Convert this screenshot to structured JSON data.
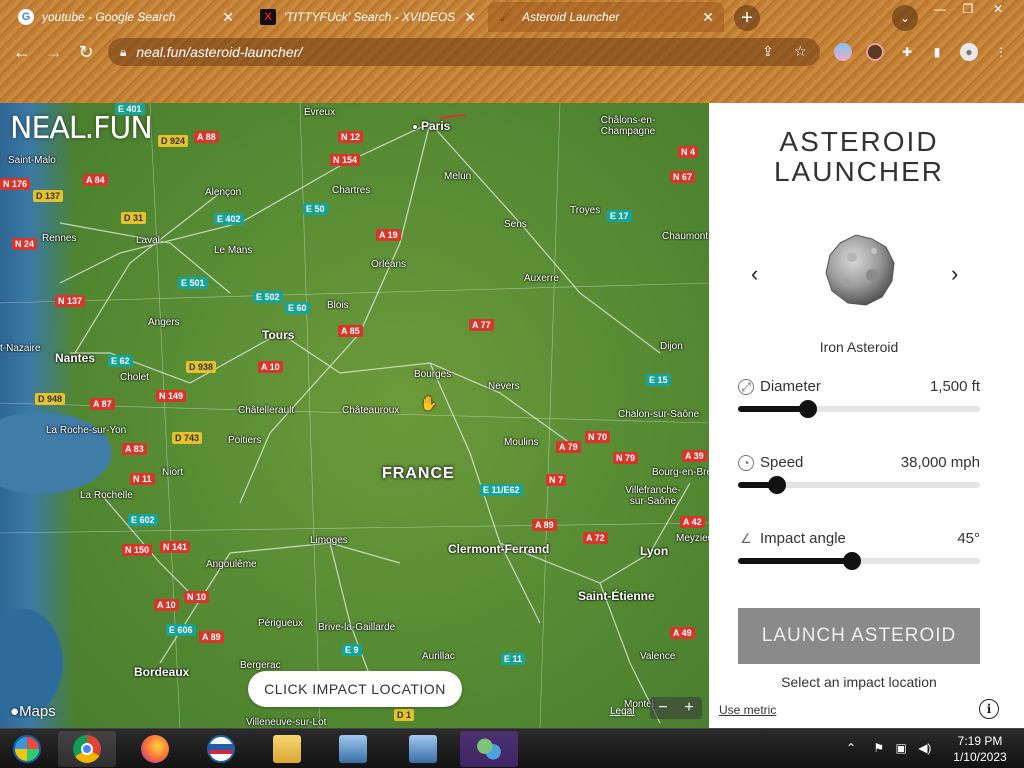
{
  "browser": {
    "tabs": [
      {
        "title": "youtube - Google Search",
        "favicon": "google-icon",
        "active": false
      },
      {
        "title": "'TITTYFUck' Search - XVIDEOS",
        "favicon": "x-icon",
        "active": false
      },
      {
        "title": "Asteroid Launcher",
        "favicon": "asteroid-icon",
        "active": true
      }
    ],
    "close_glyph": "✕",
    "new_tab_glyph": "+",
    "url": "neal.fun/asteroid-launcher/"
  },
  "map": {
    "logo": "NEAL.FUN",
    "country_label": "FRANCE",
    "maps_attribution": "Maps",
    "legal": "Legal",
    "zoom_out": "−",
    "zoom_in": "+",
    "impact_prompt": "CLICK IMPACT LOCATION",
    "cities": {
      "paris": "Paris",
      "evreux": "Évreux",
      "chalons": "Châlons-en-Champagne",
      "saint_malo": "Saint-Malo",
      "alencon": "Alençon",
      "chartres": "Chartres",
      "melun": "Melun",
      "troyes": "Troyes",
      "rennes": "Rennes",
      "laval": "Laval",
      "le_mans": "Le Mans",
      "sens": "Sens",
      "chaumont": "Chaumont",
      "orleans": "Orléans",
      "auxerre": "Auxerre",
      "angers": "Angers",
      "blois": "Blois",
      "tours": "Tours",
      "nazaire": "t-Nazaire",
      "nantes": "Nantes",
      "dijon": "Dijon",
      "cholet": "Cholet",
      "bourges": "Bourges",
      "nevers": "Nevers",
      "chatellerault": "Châtellerault",
      "chateauroux": "Châteauroux",
      "chalon": "Chalon-sur-Saône",
      "roche_yon": "La Roche-sur-Yon",
      "poitiers": "Poitiers",
      "moulins": "Moulins",
      "bourg": "Bourg-en-Bresse",
      "niort": "Niort",
      "rochelle": "La Rochelle",
      "villefranche": "Villefranche-sur-Saône",
      "limoges": "Limoges",
      "clermont": "Clermont-Ferrand",
      "lyon": "Lyon",
      "meyzieu": "Meyzieu",
      "angouleme": "Angoulême",
      "saint_etienne": "Saint-Étienne",
      "perigueux": "Périgueux",
      "brive": "Brive-la-Gaillarde",
      "bordeaux": "Bordeaux",
      "bergerac": "Bergerac",
      "aurillac": "Aurillac",
      "valence": "Valence",
      "montel": "Montel",
      "villeneuve": "Villeneuve-sur-Lot"
    },
    "roads": {
      "e401": "E 401",
      "a88": "A 88",
      "d924": "D 924",
      "n12": "N 12",
      "n154": "N 154",
      "n4": "N 4",
      "n67": "N 67",
      "n176": "N 176",
      "a84": "A 84",
      "d137": "D 137",
      "e50": "E 50",
      "d31": "D 31",
      "e402": "E 402",
      "e17": "E 17",
      "a19": "A 19",
      "n24": "N 24",
      "e501": "E 501",
      "e502": "E 502",
      "e60": "E 60",
      "n137": "N 137",
      "a77": "A 77",
      "a85": "A 85",
      "e62": "E 62",
      "d938": "D 938",
      "a10": "A 10",
      "e15": "E 15",
      "d948": "D 948",
      "a87": "A 87",
      "n149": "N 149",
      "d743": "D 743",
      "a83": "A 83",
      "a79": "A 79",
      "n70": "N 70",
      "a39": "A 39",
      "n79": "N 79",
      "n11": "N 11",
      "n7": "N 7",
      "e11": "E 11/E62",
      "e602": "E 602",
      "a89": "A 89",
      "a42": "A 42",
      "a72": "A 72",
      "n150": "N 150",
      "n141": "N 141",
      "a10b": "A 10",
      "n10": "N 10",
      "e606": "E 606",
      "a89b": "A 89",
      "e9": "E 9",
      "e11b": "E 11",
      "a49": "A 49",
      "d1": "D 1"
    }
  },
  "panel": {
    "title_line1": "ASTEROID",
    "title_line2": "LAUNCHER",
    "prev_glyph": "‹",
    "next_glyph": "›",
    "asteroid_name": "Iron Asteroid",
    "sliders": [
      {
        "label": "Diameter",
        "value": "1,500 ft",
        "fraction": 0.29,
        "icon": "diameter-icon"
      },
      {
        "label": "Speed",
        "value": "38,000 mph",
        "fraction": 0.16,
        "icon": "speedometer-icon"
      },
      {
        "label": "Impact angle",
        "value": "45°",
        "fraction": 0.47,
        "icon": "angle-icon"
      }
    ],
    "launch_label": "LAUNCH ASTEROID",
    "hint": "Select an impact location",
    "metric_link": "Use metric",
    "info_glyph": "i"
  },
  "taskbar": {
    "time": "7:19 PM",
    "date": "1/10/2023"
  },
  "colors": {
    "panel_bg": "#ffffff",
    "launch_disabled": "#8a8a8a",
    "slider_fill": "#111111",
    "road_red": "#d9362b",
    "road_green": "#15a39a",
    "road_yellow": "#e5c22b"
  }
}
